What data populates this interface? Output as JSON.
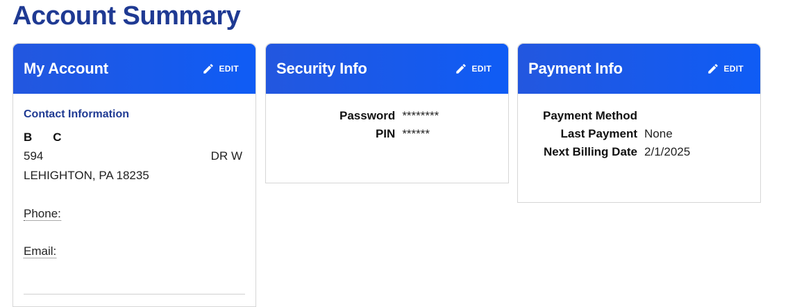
{
  "page": {
    "title": "Account Summary"
  },
  "account_card": {
    "title": "My Account",
    "edit_label": "EDIT",
    "section_heading": "Contact Information",
    "name_first": "B",
    "name_last": "C",
    "address_line1_start": "594",
    "address_line1_end": "DR W",
    "address_line2": "LEHIGHTON, PA 18235",
    "phone_label": "Phone:",
    "email_label": "Email:"
  },
  "security_card": {
    "title": "Security Info",
    "edit_label": "EDIT",
    "rows": [
      {
        "label": "Password",
        "value": "********"
      },
      {
        "label": "PIN",
        "value": "******"
      }
    ]
  },
  "payment_card": {
    "title": "Payment Info",
    "edit_label": "EDIT",
    "rows": [
      {
        "label": "Payment Method",
        "value": ""
      },
      {
        "label": "Last Payment",
        "value": "None"
      },
      {
        "label": "Next Billing Date",
        "value": "2/1/2025"
      }
    ]
  },
  "icons": {
    "edit": "pencil-icon"
  },
  "colors": {
    "brand_title": "#1f3a93",
    "header_blue": "#0f5cf5"
  }
}
